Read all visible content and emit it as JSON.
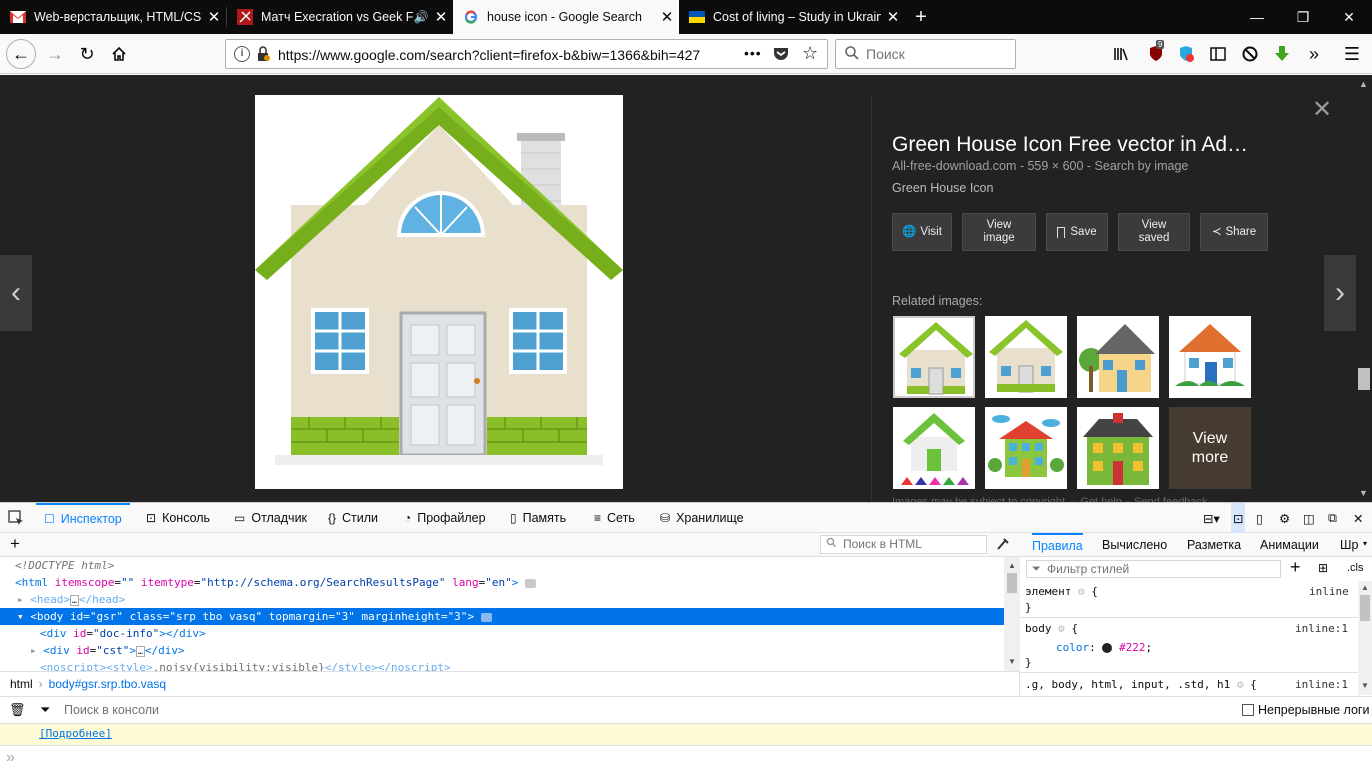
{
  "tabs": [
    {
      "title": "Web-верстальщик, HTML/CSS",
      "icon": "gmail-icon"
    },
    {
      "title": "Матч Execration vs Geek Fa",
      "icon": "match-site-icon",
      "audio": "speaker-icon"
    },
    {
      "title": "house icon - Google Search",
      "icon": "google-icon"
    },
    {
      "title": "Cost of living – Study in Ukraine",
      "icon": "ukraine-flag-icon"
    }
  ],
  "nav": {
    "url": "https://www.google.com/search?client=firefox-b&biw=1366&bih=427",
    "search_placeholder": "Поиск",
    "page_actions": "•••"
  },
  "toolbar": {
    "badge": "9"
  },
  "viewer": {
    "title": "Green House Icon Free vector in Ad…",
    "source": "All-free-download.com",
    "dims": "559 × 600",
    "search_by_image": "Search by image",
    "description": "Green House Icon",
    "sep": " - ",
    "buttons": {
      "visit": "Visit",
      "view_image": "View image",
      "save": "Save",
      "view_saved": "View saved",
      "share": "Share"
    },
    "related_header": "Related images:",
    "view_more": "View more",
    "copyright": "Images may be subject to copyright.",
    "get_help": "Get help",
    "send_feedback": "Send feedback",
    "link_sep": " – "
  },
  "devtools": {
    "tabs": [
      "Инспектор",
      "Консоль",
      "Отладчик",
      "Стили",
      "Профайлер",
      "Память",
      "Сеть",
      "Хранилище"
    ],
    "html_search_placeholder": "Поиск в HTML",
    "breadcrumbs": [
      "html",
      "body#gsr.srp.tbo.vasq"
    ],
    "rules_tabs": [
      "Правила",
      "Вычислено",
      "Разметка",
      "Анимации",
      "Шр"
    ],
    "filter_placeholder": "Фильтр стилей",
    "cls": ".cls",
    "rules": {
      "element_selector": "элемент",
      "element_source": "inline",
      "body_selector": "body",
      "body_source": "inline:1",
      "body_prop": "color",
      "body_value": "#222",
      "third_selector": ".g, body, html, input, .std, h1",
      "third_source": "inline:1"
    },
    "console": {
      "filter_placeholder": "Поиск в консоли",
      "persist_label": "Непрерывные логи",
      "learn_more": "[Подробнее]"
    }
  },
  "colors": {
    "accent": "#0a84ff",
    "selected_row": "#0074e8",
    "content_bg": "#222222"
  }
}
